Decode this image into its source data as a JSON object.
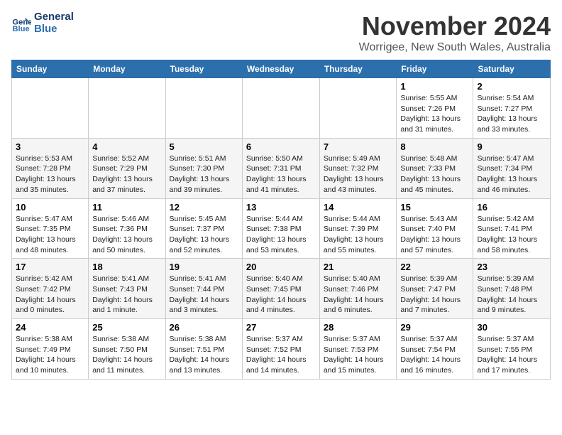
{
  "header": {
    "logo_line1": "General",
    "logo_line2": "Blue",
    "month": "November 2024",
    "location": "Worrigee, New South Wales, Australia"
  },
  "weekdays": [
    "Sunday",
    "Monday",
    "Tuesday",
    "Wednesday",
    "Thursday",
    "Friday",
    "Saturday"
  ],
  "weeks": [
    [
      {
        "day": "",
        "info": ""
      },
      {
        "day": "",
        "info": ""
      },
      {
        "day": "",
        "info": ""
      },
      {
        "day": "",
        "info": ""
      },
      {
        "day": "",
        "info": ""
      },
      {
        "day": "1",
        "info": "Sunrise: 5:55 AM\nSunset: 7:26 PM\nDaylight: 13 hours and 31 minutes."
      },
      {
        "day": "2",
        "info": "Sunrise: 5:54 AM\nSunset: 7:27 PM\nDaylight: 13 hours and 33 minutes."
      }
    ],
    [
      {
        "day": "3",
        "info": "Sunrise: 5:53 AM\nSunset: 7:28 PM\nDaylight: 13 hours and 35 minutes."
      },
      {
        "day": "4",
        "info": "Sunrise: 5:52 AM\nSunset: 7:29 PM\nDaylight: 13 hours and 37 minutes."
      },
      {
        "day": "5",
        "info": "Sunrise: 5:51 AM\nSunset: 7:30 PM\nDaylight: 13 hours and 39 minutes."
      },
      {
        "day": "6",
        "info": "Sunrise: 5:50 AM\nSunset: 7:31 PM\nDaylight: 13 hours and 41 minutes."
      },
      {
        "day": "7",
        "info": "Sunrise: 5:49 AM\nSunset: 7:32 PM\nDaylight: 13 hours and 43 minutes."
      },
      {
        "day": "8",
        "info": "Sunrise: 5:48 AM\nSunset: 7:33 PM\nDaylight: 13 hours and 45 minutes."
      },
      {
        "day": "9",
        "info": "Sunrise: 5:47 AM\nSunset: 7:34 PM\nDaylight: 13 hours and 46 minutes."
      }
    ],
    [
      {
        "day": "10",
        "info": "Sunrise: 5:47 AM\nSunset: 7:35 PM\nDaylight: 13 hours and 48 minutes."
      },
      {
        "day": "11",
        "info": "Sunrise: 5:46 AM\nSunset: 7:36 PM\nDaylight: 13 hours and 50 minutes."
      },
      {
        "day": "12",
        "info": "Sunrise: 5:45 AM\nSunset: 7:37 PM\nDaylight: 13 hours and 52 minutes."
      },
      {
        "day": "13",
        "info": "Sunrise: 5:44 AM\nSunset: 7:38 PM\nDaylight: 13 hours and 53 minutes."
      },
      {
        "day": "14",
        "info": "Sunrise: 5:44 AM\nSunset: 7:39 PM\nDaylight: 13 hours and 55 minutes."
      },
      {
        "day": "15",
        "info": "Sunrise: 5:43 AM\nSunset: 7:40 PM\nDaylight: 13 hours and 57 minutes."
      },
      {
        "day": "16",
        "info": "Sunrise: 5:42 AM\nSunset: 7:41 PM\nDaylight: 13 hours and 58 minutes."
      }
    ],
    [
      {
        "day": "17",
        "info": "Sunrise: 5:42 AM\nSunset: 7:42 PM\nDaylight: 14 hours and 0 minutes."
      },
      {
        "day": "18",
        "info": "Sunrise: 5:41 AM\nSunset: 7:43 PM\nDaylight: 14 hours and 1 minute."
      },
      {
        "day": "19",
        "info": "Sunrise: 5:41 AM\nSunset: 7:44 PM\nDaylight: 14 hours and 3 minutes."
      },
      {
        "day": "20",
        "info": "Sunrise: 5:40 AM\nSunset: 7:45 PM\nDaylight: 14 hours and 4 minutes."
      },
      {
        "day": "21",
        "info": "Sunrise: 5:40 AM\nSunset: 7:46 PM\nDaylight: 14 hours and 6 minutes."
      },
      {
        "day": "22",
        "info": "Sunrise: 5:39 AM\nSunset: 7:47 PM\nDaylight: 14 hours and 7 minutes."
      },
      {
        "day": "23",
        "info": "Sunrise: 5:39 AM\nSunset: 7:48 PM\nDaylight: 14 hours and 9 minutes."
      }
    ],
    [
      {
        "day": "24",
        "info": "Sunrise: 5:38 AM\nSunset: 7:49 PM\nDaylight: 14 hours and 10 minutes."
      },
      {
        "day": "25",
        "info": "Sunrise: 5:38 AM\nSunset: 7:50 PM\nDaylight: 14 hours and 11 minutes."
      },
      {
        "day": "26",
        "info": "Sunrise: 5:38 AM\nSunset: 7:51 PM\nDaylight: 14 hours and 13 minutes."
      },
      {
        "day": "27",
        "info": "Sunrise: 5:37 AM\nSunset: 7:52 PM\nDaylight: 14 hours and 14 minutes."
      },
      {
        "day": "28",
        "info": "Sunrise: 5:37 AM\nSunset: 7:53 PM\nDaylight: 14 hours and 15 minutes."
      },
      {
        "day": "29",
        "info": "Sunrise: 5:37 AM\nSunset: 7:54 PM\nDaylight: 14 hours and 16 minutes."
      },
      {
        "day": "30",
        "info": "Sunrise: 5:37 AM\nSunset: 7:55 PM\nDaylight: 14 hours and 17 minutes."
      }
    ]
  ]
}
